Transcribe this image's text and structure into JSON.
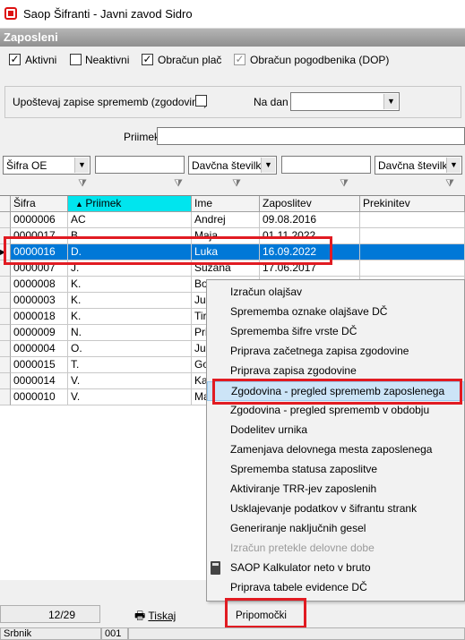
{
  "window": {
    "title": "Saop Šifranti - Javni zavod Sidro"
  },
  "panel": {
    "title": "Zaposleni"
  },
  "filters": {
    "aktivni": {
      "label": "Aktivni",
      "checked": true
    },
    "neaktivni": {
      "label": "Neaktivni",
      "checked": false
    },
    "obracun_plac": {
      "label": "Obračun plač",
      "checked": true
    },
    "obracun_pogodbenika": {
      "label": "Obračun pogodbenika (DOP)",
      "checked": true
    },
    "history": {
      "label": "Upoštevaj zapise sprememb (zgodovina)",
      "checked": false
    },
    "na_dan": {
      "label": "Na dan",
      "value": ""
    },
    "priimek": {
      "label": "Priimek",
      "value": ""
    },
    "sifra_oe": {
      "value": "Šifra OE"
    },
    "davcna1": {
      "value": "Davčna številka"
    },
    "davcna2": {
      "value": "Davčna številka"
    }
  },
  "grid": {
    "columns": [
      "Šifra",
      "Priimek",
      "Ime",
      "Zaposlitev",
      "Prekinitev"
    ],
    "rows": [
      {
        "sifra": "0000006",
        "priimek": "AC",
        "ime": "Andrej",
        "zaposlitev": "09.08.2016",
        "prekinitev": ""
      },
      {
        "sifra": "0000017",
        "priimek": "B.",
        "ime": "Maja",
        "zaposlitev": "01.11.2022",
        "prekinitev": ""
      },
      {
        "sifra": "0000016",
        "priimek": "D.",
        "ime": "Luka",
        "zaposlitev": "16.09.2022",
        "prekinitev": ""
      },
      {
        "sifra": "0000007",
        "priimek": "J.",
        "ime": "Suzana",
        "zaposlitev": "17.06.2017",
        "prekinitev": ""
      },
      {
        "sifra": "0000008",
        "priimek": "K.",
        "ime": "Bo",
        "zaposlitev": "",
        "prekinitev": ""
      },
      {
        "sifra": "0000003",
        "priimek": "K.",
        "ime": "Ju",
        "zaposlitev": "",
        "prekinitev": ""
      },
      {
        "sifra": "0000018",
        "priimek": "K.",
        "ime": "Tir",
        "zaposlitev": "",
        "prekinitev": ""
      },
      {
        "sifra": "0000009",
        "priimek": "N.",
        "ime": "Pri",
        "zaposlitev": "",
        "prekinitev": ""
      },
      {
        "sifra": "0000004",
        "priimek": "O.",
        "ime": "Ju",
        "zaposlitev": "",
        "prekinitev": ""
      },
      {
        "sifra": "0000015",
        "priimek": "T.",
        "ime": "Go",
        "zaposlitev": "",
        "prekinitev": ""
      },
      {
        "sifra": "0000014",
        "priimek": "V.",
        "ime": "Ka",
        "zaposlitev": "",
        "prekinitev": ""
      },
      {
        "sifra": "0000010",
        "priimek": "V.",
        "ime": "Ma",
        "zaposlitev": "",
        "prekinitev": ""
      }
    ],
    "selected_index": 2
  },
  "context_menu": {
    "items": [
      {
        "label": "Izračun olajšav",
        "enabled": true
      },
      {
        "label": "Sprememba oznake olajšave DČ",
        "enabled": true
      },
      {
        "label": "Sprememba šifre vrste DČ",
        "enabled": true
      },
      {
        "label": "Priprava začetnega zapisa zgodovine",
        "enabled": true
      },
      {
        "label": "Priprava zapisa zgodovine",
        "enabled": true
      },
      {
        "label": "Zgodovina - pregled sprememb zaposlenega",
        "enabled": true,
        "highlighted": true
      },
      {
        "label": "Zgodovina - pregled sprememb v obdobju",
        "enabled": true
      },
      {
        "label": "Dodelitev urnika",
        "enabled": true
      },
      {
        "label": "Zamenjava delovnega mesta zaposlenega",
        "enabled": true
      },
      {
        "label": "Sprememba statusa zaposlitve",
        "enabled": true
      },
      {
        "label": "Aktiviranje TRR-jev zaposlenih",
        "enabled": true
      },
      {
        "label": "Usklajevanje podatkov v šifrantu strank",
        "enabled": true
      },
      {
        "label": "Generiranje naključnih gesel",
        "enabled": true
      },
      {
        "label": "Izračun pretekle delovne dobe",
        "enabled": false
      },
      {
        "label": "SAOP Kalkulator neto v bruto",
        "enabled": true,
        "icon": "calculator-icon"
      },
      {
        "label": "Priprava tabele evidence DČ",
        "enabled": true
      }
    ]
  },
  "footer": {
    "record_counter": "12/29",
    "print_label": "Tiskaj",
    "tools_label": "Pripomočki"
  },
  "statusbar": {
    "user": "Srbnik",
    "code": "001"
  },
  "colors": {
    "selection": "#0078d7",
    "sorted_header": "#00e5ee",
    "highlight_box": "#e11b22"
  }
}
